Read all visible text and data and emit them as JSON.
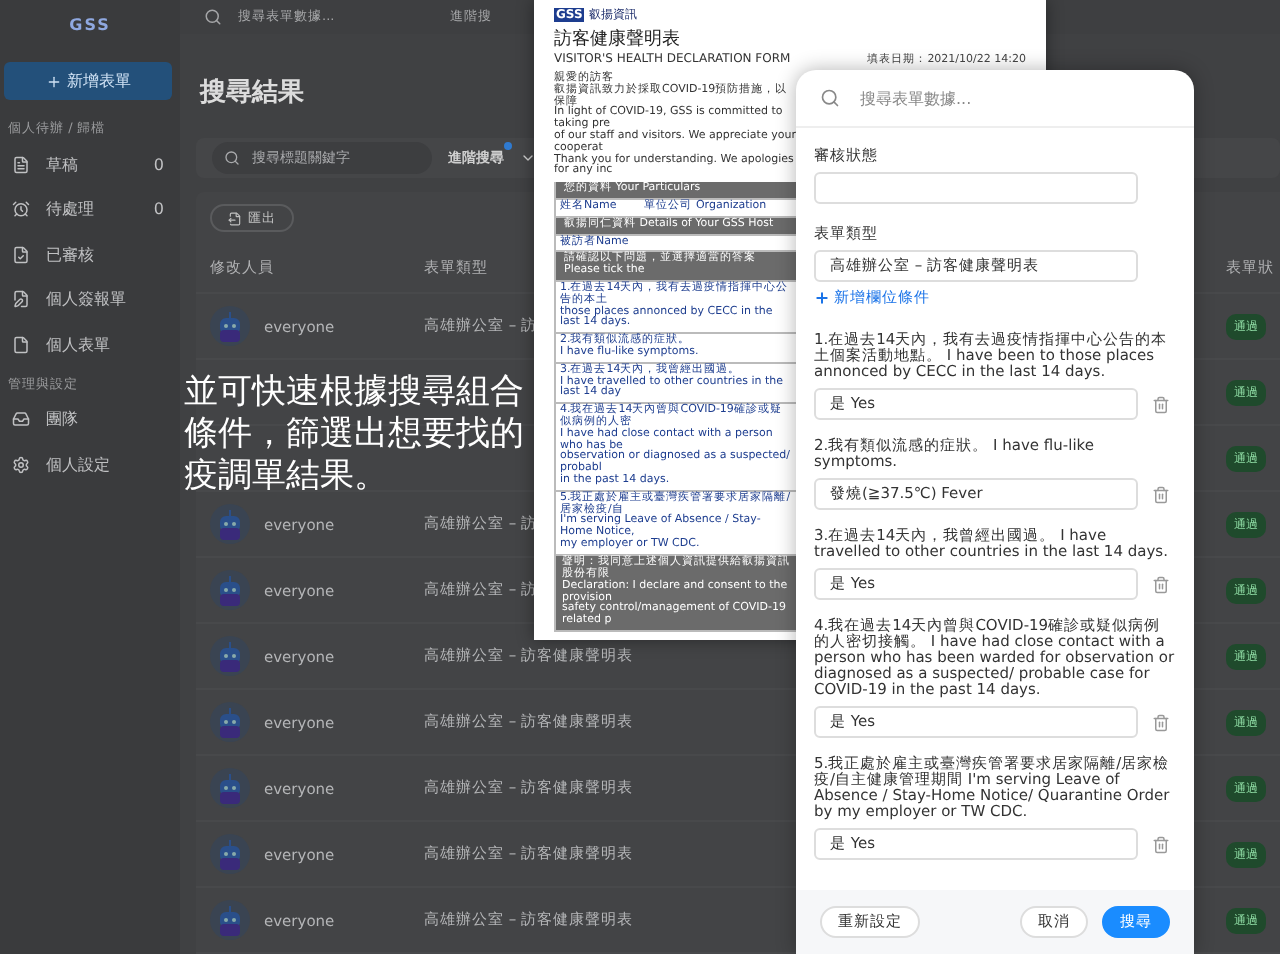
{
  "sidebar": {
    "logo": "GSS",
    "new_button": "新增表單",
    "sections": [
      {
        "title": "個人待辦 / 歸檔",
        "items": [
          {
            "label": "草稿",
            "count": "0"
          },
          {
            "label": "待處理",
            "count": "0"
          },
          {
            "label": "已審核"
          },
          {
            "label": "個人簽報單"
          },
          {
            "label": "個人表單"
          }
        ]
      },
      {
        "title": "管理與設定",
        "items": [
          {
            "label": "團隊"
          },
          {
            "label": "個人設定"
          }
        ]
      }
    ]
  },
  "top_search": {
    "placeholder": "搜尋表單數據...",
    "advanced": "進階搜"
  },
  "heading": "搜尋結果",
  "search_card": {
    "placeholder": "搜尋標題關鍵字",
    "advanced": "進階搜尋",
    "filter_active": true
  },
  "export_button": "匯出",
  "table": {
    "columns": [
      "修改人員",
      "表單類型",
      "表單狀"
    ],
    "rows": [
      {
        "user": "everyone",
        "type": "高雄辦公室 – 訪",
        "status": "通過"
      },
      {
        "status": "通過"
      },
      {
        "status": "通過"
      },
      {
        "user": "everyone",
        "type": "高雄辦公室 – 訪",
        "status": "通過"
      },
      {
        "user": "everyone",
        "type": "高雄辦公室 – 訪",
        "status": "通過"
      },
      {
        "user": "everyone",
        "type": "高雄辦公室 – 訪客健康聲明表",
        "status": "通過"
      },
      {
        "user": "everyone",
        "type": "高雄辦公室 – 訪客健康聲明表",
        "status": "通過"
      },
      {
        "user": "everyone",
        "type": "高雄辦公室 – 訪客健康聲明表",
        "status": "通過"
      },
      {
        "user": "everyone",
        "type": "高雄辦公室 – 訪客健康聲明表",
        "status": "通過"
      },
      {
        "user": "everyone",
        "type": "高雄辦公室 – 訪客健康聲明表",
        "status": "通過"
      }
    ]
  },
  "document": {
    "logo": "GSS",
    "brand": "叡揚資訊",
    "title": "訪客健康聲明表",
    "title_en": "VISITOR'S HEALTH DECLARATION FORM",
    "date": "填表日期：2021/10/22 14:20",
    "intro": [
      "親愛的訪客",
      "叡揚資訊致力於採取COVID-19預防措施，以保障",
      "In light of COVID-19, GSS is committed to taking pre",
      "of our staff and visitors. We appreciate your cooperat",
      "Thank you for understanding. We apologies for any inc"
    ],
    "rows": [
      {
        "kind": "header",
        "lines": [
          "您的資料 Your Particulars"
        ]
      },
      {
        "kind": "fields",
        "lines": [
          "姓名Name",
          "單位公司 Organization"
        ]
      },
      {
        "kind": "header",
        "lines": [
          "叡揚同仁資料 Details of Your GSS Host"
        ]
      },
      {
        "kind": "fields",
        "lines": [
          "被訪者Name"
        ]
      },
      {
        "kind": "header",
        "lines": [
          "請確認以下問題，並選擇適當的答案 Please tick the"
        ]
      },
      {
        "kind": "question",
        "lines": [
          "1.在過去14天內，我有去過疫情指揮中心公告的本土",
          "those places annonced by CECC in the last 14 days."
        ]
      },
      {
        "kind": "question",
        "lines": [
          "2.我有類似流感的症狀。",
          "I have flu-like symptoms."
        ]
      },
      {
        "kind": "question",
        "lines": [
          "3.在過去14天內，我曾經出國過。",
          "I have travelled to other countries in the last 14 day"
        ]
      },
      {
        "kind": "question",
        "lines": [
          "4.我在過去14天內曾與COVID-19確診或疑似病例的人密",
          "I have had close contact with a person who has be",
          "observation or diagnosed as a suspected/ probabl",
          "in the past 14 days."
        ]
      },
      {
        "kind": "question",
        "lines": [
          "5.我正處於雇主或臺灣疾管署要求居家隔離/居家檢疫/自",
          "I'm serving Leave of Absence / Stay-Home Notice,",
          "my employer or TW CDC."
        ]
      },
      {
        "kind": "footer",
        "lines": [
          "聲明：我同意上述個人資訊提供給叡揚資訊股份有限",
          "Declaration: I declare and consent to the provision",
          "safety control/management of COVID-19 related p"
        ]
      }
    ]
  },
  "caption": "並可快速根據搜尋組合條件，篩選出想要找的疫調單結果。",
  "filter_panel": {
    "search_placeholder": "搜尋表單數據...",
    "fields": [
      {
        "label": "審核狀態"
      },
      {
        "label": "表單類型",
        "value": "高雄辦公室 – 訪客健康聲明表"
      }
    ],
    "add_condition": "新增欄位條件",
    "questions": [
      {
        "label": "1.在過去14天內，我有去過疫情指揮中心公告的本土個案活動地點。 I have been to those places annonced by CECC in the last 14 days.",
        "value": "是 Yes"
      },
      {
        "label": "2.我有類似流感的症狀。 I have flu-like symptoms.",
        "value": "發燒(≧37.5℃) Fever"
      },
      {
        "label": "3.在過去14天內，我曾經出國過。 I have travelled to other countries in the last 14 days.",
        "value": "是 Yes"
      },
      {
        "label": "4.我在過去14天內曾與COVID-19確診或疑似病例的人密切接觸。 I have had close contact with a person who has been warded for observation or diagnosed as a suspected/ probable case for COVID-19 in the past 14 days.",
        "value": "是 Yes"
      },
      {
        "label": "5.我正處於雇主或臺灣疾管署要求居家隔離/居家檢疫/自主健康管理期間 I'm serving Leave of Absence / Stay-Home Notice/ Quarantine Order by my employer or TW CDC.",
        "value": "是 Yes"
      }
    ],
    "buttons": {
      "reset": "重新設定",
      "cancel": "取消",
      "search": "搜尋"
    }
  }
}
